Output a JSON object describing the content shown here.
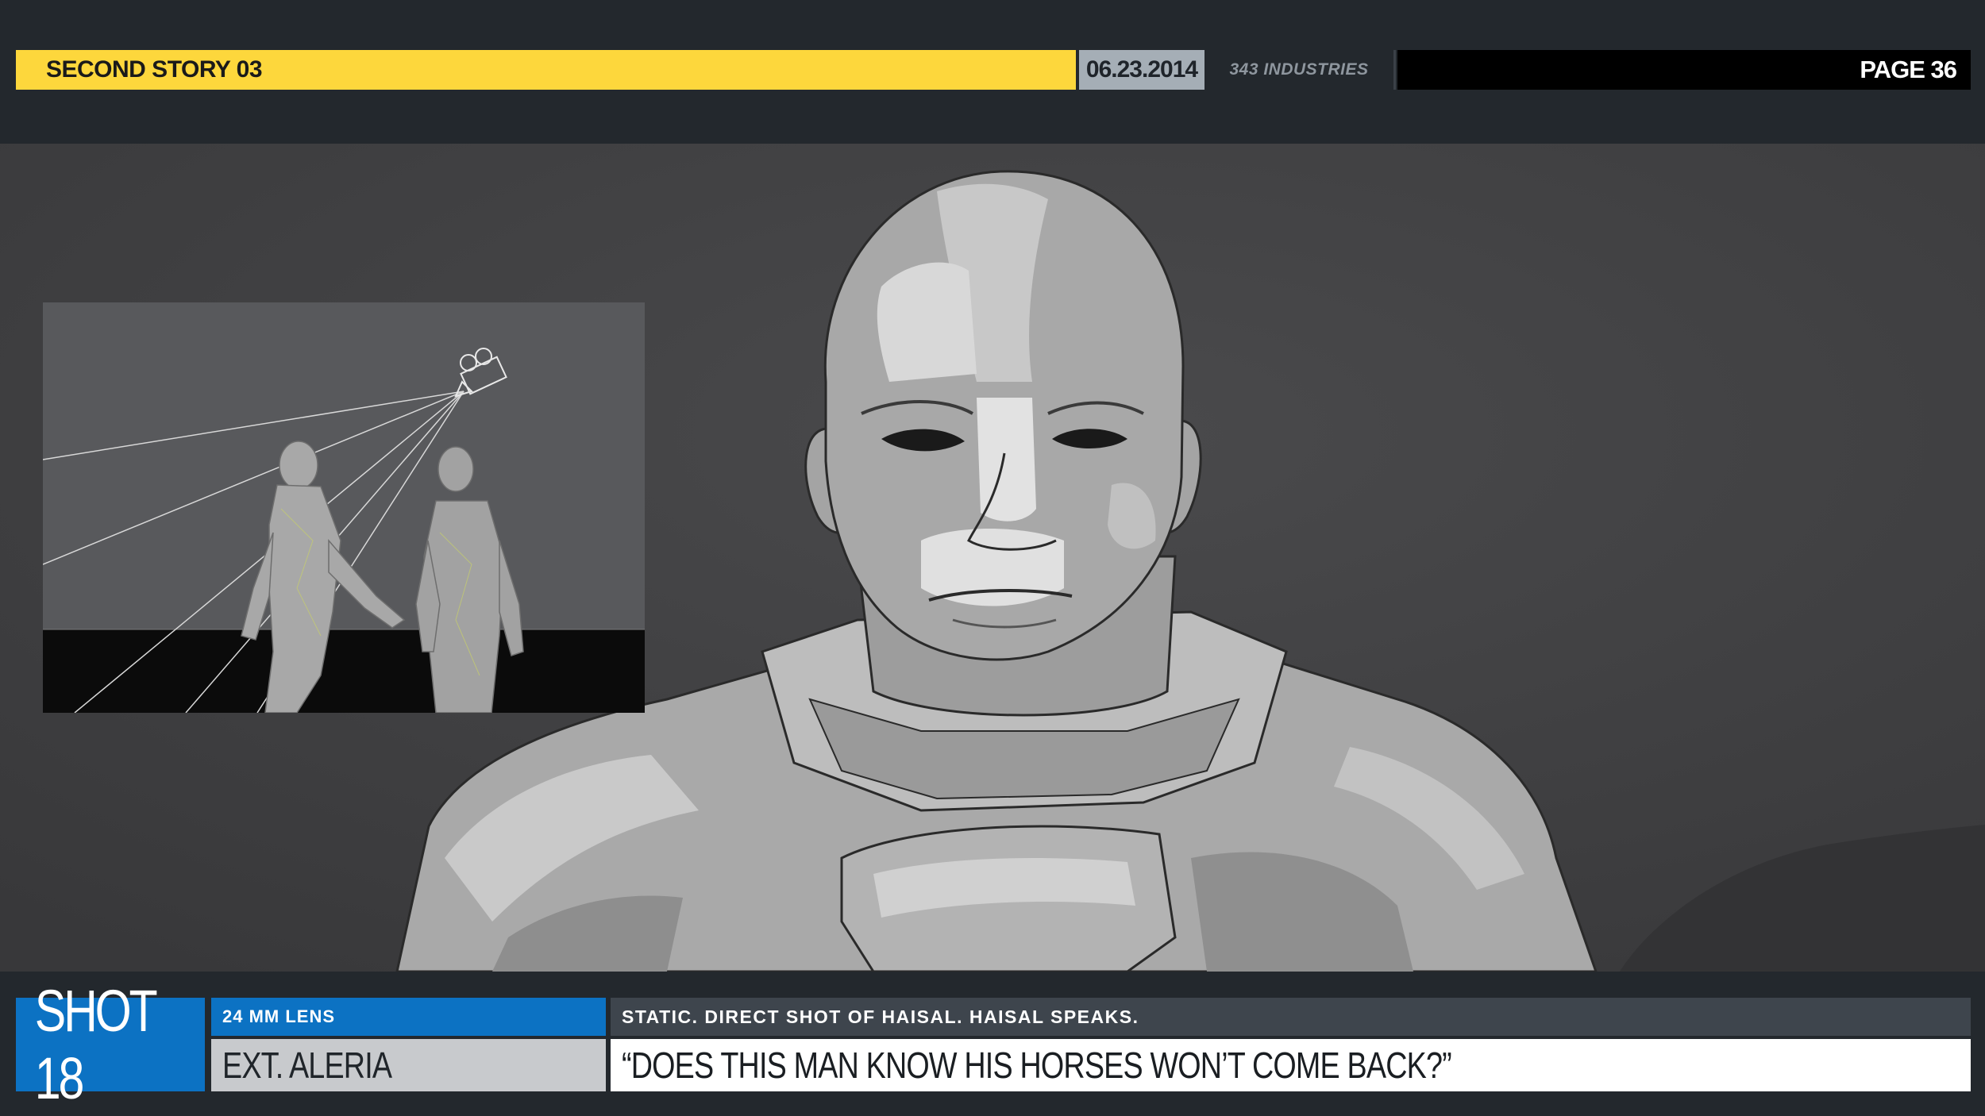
{
  "header": {
    "title": "SECOND STORY 03",
    "date": "06.23.2014",
    "studio": "343 INDUSTRIES",
    "page": "PAGE 36",
    "colors": {
      "title_bg": "#fdd73c",
      "date_bg": "#a5aeb6",
      "page_bg": "#000000"
    }
  },
  "frame": {
    "main_image": "storyboard-panel-bald-soldier-closeup",
    "inset_image": "3d-previs-two-figures-with-camera-frustum"
  },
  "shot": {
    "label": "SHOT 18",
    "lens": "24 MM LENS",
    "location": "EXT.  ALERIA",
    "description": "STATIC.  DIRECT SHOT OF HAISAL. HAISAL SPEAKS.",
    "dialogue": "“DOES THIS MAN KNOW HIS HORSES WON’T COME BACK?”",
    "accent_color": "#0c72c3"
  }
}
